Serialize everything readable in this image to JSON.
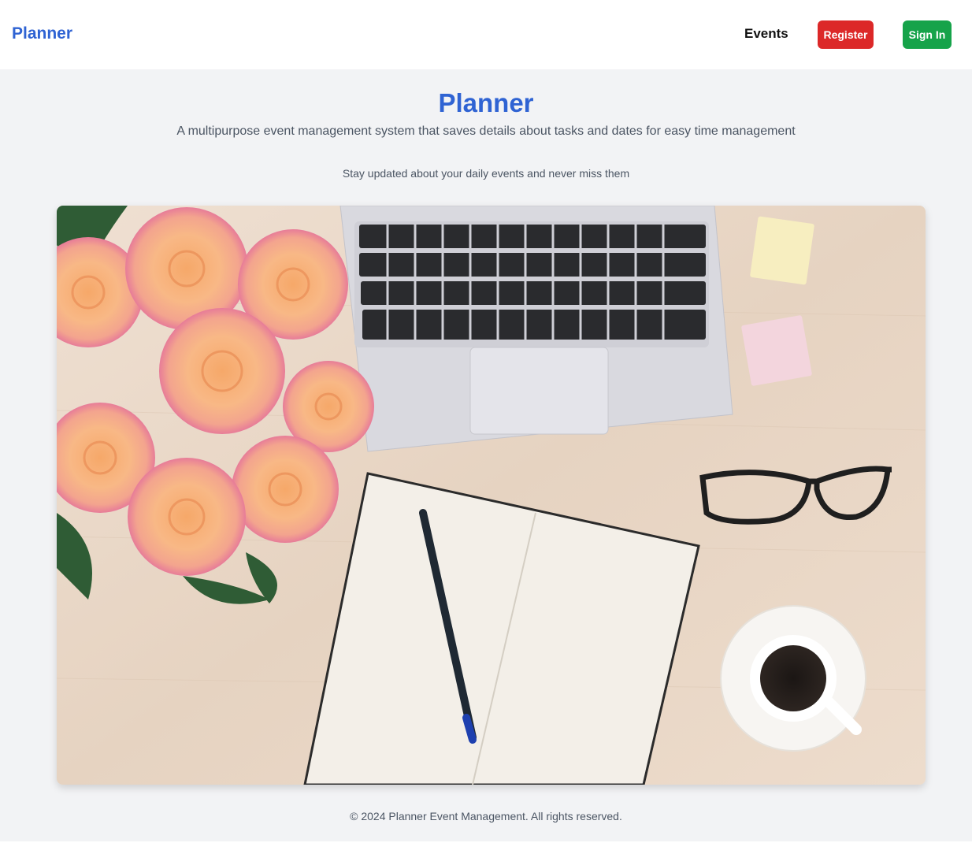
{
  "nav": {
    "brand": "Planner",
    "events_label": "Events",
    "register_label": "Register",
    "signin_label": "Sign In"
  },
  "hero": {
    "title": "Planner",
    "subtitle": "A multipurpose event management system that saves details about tasks and dates for easy time management",
    "tagline": "Stay updated about your daily events and never miss them"
  },
  "footer": {
    "copyright": "© 2024 Planner Event Management. All rights reserved."
  },
  "colors": {
    "brand": "#2f63d3",
    "register": "#dc2828",
    "signin": "#16a34a",
    "background": "#f2f3f5"
  }
}
